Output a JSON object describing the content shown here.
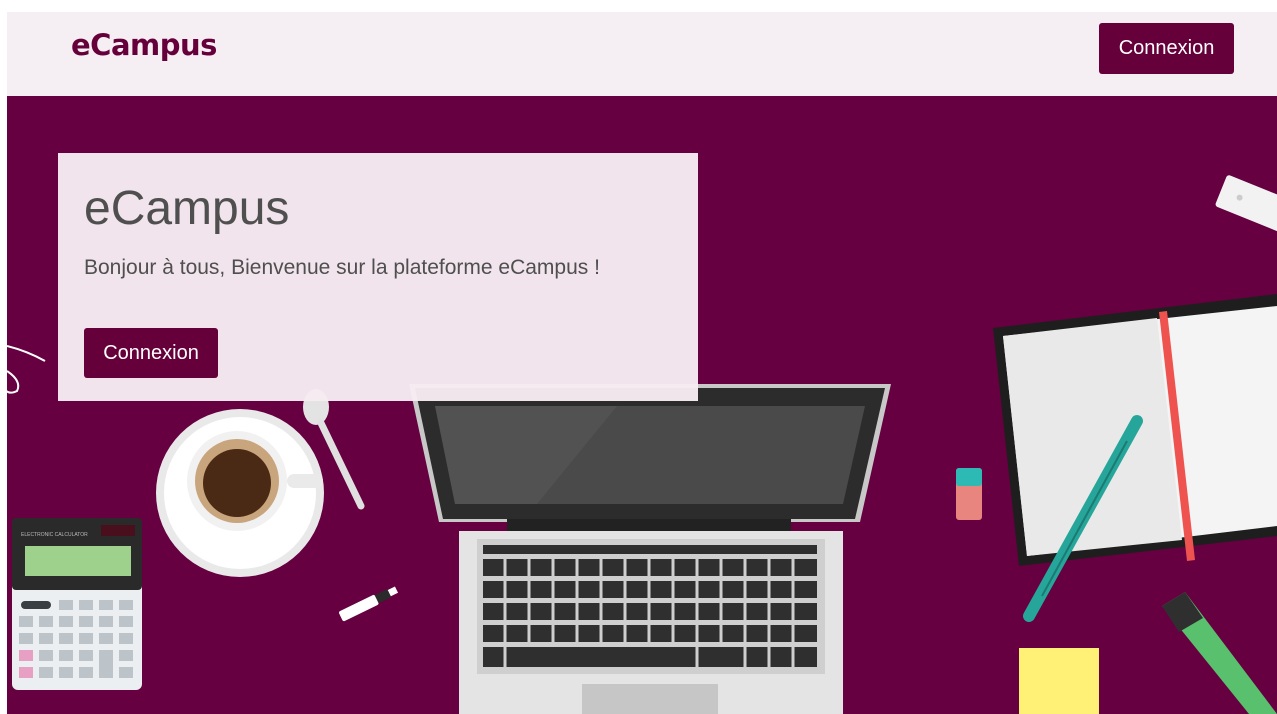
{
  "navbar": {
    "brand": "eCampus",
    "login_label": "Connexion"
  },
  "hero": {
    "title": "eCampus",
    "subtitle": "Bonjour à tous, Bienvenue sur la plateforme eCampus !",
    "login_label": "Connexion",
    "calculator_label": "ELECTRONIC CALCULATOR"
  },
  "colors": {
    "brand": "#66003a",
    "hero_background": "#660040",
    "navbar_background": "#f5eff4",
    "panel_background": "#f6ebf2"
  }
}
